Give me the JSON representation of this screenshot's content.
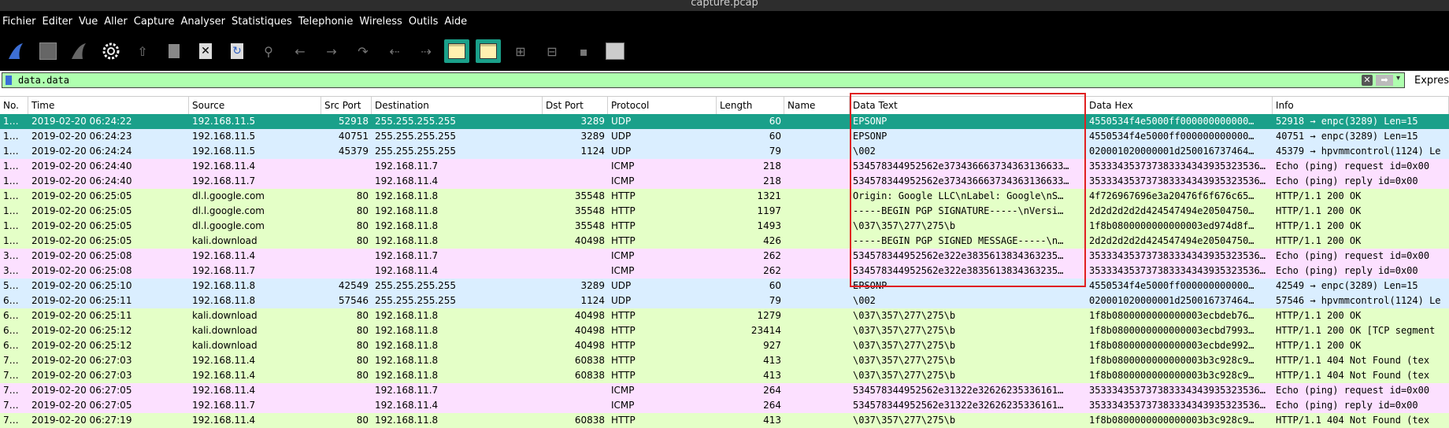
{
  "window": {
    "title": "capture.pcap"
  },
  "menu": [
    "Fichier",
    "Editer",
    "Vue",
    "Aller",
    "Capture",
    "Analyser",
    "Statistiques",
    "Telephonie",
    "Wireless",
    "Outils",
    "Aide"
  ],
  "toolbar": {
    "icons": [
      "shark-fin-icon",
      "stop-icon",
      "restart-icon",
      "options-gear-icon",
      "open-file-icon",
      "save-file-icon",
      "close-file-icon",
      "reload-icon",
      "find-icon",
      "back-icon",
      "forward-icon",
      "goto-icon",
      "first-icon",
      "last-icon",
      "autoscroll-icon",
      "colorize-icon",
      "zoom-in-icon",
      "zoom-out-icon",
      "normal-size-icon",
      "resize-columns-icon"
    ]
  },
  "filter": {
    "value": "data.data",
    "expression_label": "Express"
  },
  "columns": [
    "No.",
    "Time",
    "Source",
    "Src Port",
    "Destination",
    "Dst Port",
    "Protocol",
    "Length",
    "Name",
    "Data Text",
    "Data Hex",
    "Info"
  ],
  "packets": [
    {
      "no": "1…",
      "time": "2019-02-20 06:24:22",
      "src": "192.168.11.5",
      "sport": "52918",
      "dst": "255.255.255.255",
      "dport": "3289",
      "proto": "UDP",
      "len": "60",
      "name": "",
      "text": "EPSONP",
      "hex": "4550534f4e5000ff000000000000…",
      "info": "52918 → enpc(3289) Len=15",
      "cls": "sel"
    },
    {
      "no": "1…",
      "time": "2019-02-20 06:24:23",
      "src": "192.168.11.5",
      "sport": "40751",
      "dst": "255.255.255.255",
      "dport": "3289",
      "proto": "UDP",
      "len": "60",
      "name": "",
      "text": "EPSONP",
      "hex": "4550534f4e5000ff000000000000…",
      "info": "40751 → enpc(3289) Len=15",
      "cls": "udp"
    },
    {
      "no": "1…",
      "time": "2019-02-20 06:24:24",
      "src": "192.168.11.5",
      "sport": "45379",
      "dst": "255.255.255.255",
      "dport": "1124",
      "proto": "UDP",
      "len": "79",
      "name": "",
      "text": "\\002",
      "hex": "020001020000001d250016737464…",
      "info": "45379 → hpvmmcontrol(1124) Le",
      "cls": "udp"
    },
    {
      "no": "1…",
      "time": "2019-02-20 06:24:40",
      "src": "192.168.11.4",
      "sport": "",
      "dst": "192.168.11.7",
      "dport": "",
      "proto": "ICMP",
      "len": "218",
      "name": "",
      "text": "534578344952562e373436663734363136633…",
      "hex": "353334353737383334343935323536…",
      "info": "Echo (ping) request  id=0x00",
      "cls": "icmp"
    },
    {
      "no": "1…",
      "time": "2019-02-20 06:24:40",
      "src": "192.168.11.7",
      "sport": "",
      "dst": "192.168.11.4",
      "dport": "",
      "proto": "ICMP",
      "len": "218",
      "name": "",
      "text": "534578344952562e373436663734363136633…",
      "hex": "353334353737383334343935323536…",
      "info": "Echo (ping) reply    id=0x00",
      "cls": "icmp"
    },
    {
      "no": "1…",
      "time": "2019-02-20 06:25:05",
      "src": "dl.l.google.com",
      "sport": "80",
      "dst": "192.168.11.8",
      "dport": "35548",
      "proto": "HTTP",
      "len": "1321",
      "name": "",
      "text": "Origin: Google LLC\\nLabel: Google\\nS…",
      "hex": "4f726967696e3a20476f6f676c65…",
      "info": "HTTP/1.1 200 OK",
      "cls": "http"
    },
    {
      "no": "1…",
      "time": "2019-02-20 06:25:05",
      "src": "dl.l.google.com",
      "sport": "80",
      "dst": "192.168.11.8",
      "dport": "35548",
      "proto": "HTTP",
      "len": "1197",
      "name": "",
      "text": "-----BEGIN PGP SIGNATURE-----\\nVersi…",
      "hex": "2d2d2d2d2d424547494e20504750…",
      "info": "HTTP/1.1 200 OK",
      "cls": "http"
    },
    {
      "no": "1…",
      "time": "2019-02-20 06:25:05",
      "src": "dl.l.google.com",
      "sport": "80",
      "dst": "192.168.11.8",
      "dport": "35548",
      "proto": "HTTP",
      "len": "1493",
      "name": "",
      "text": "\\037\\357\\277\\275\\b",
      "hex": "1f8b0800000000000003ed974d8f…",
      "info": "HTTP/1.1 200 OK",
      "cls": "http"
    },
    {
      "no": "1…",
      "time": "2019-02-20 06:25:05",
      "src": "kali.download",
      "sport": "80",
      "dst": "192.168.11.8",
      "dport": "40498",
      "proto": "HTTP",
      "len": "426",
      "name": "",
      "text": "-----BEGIN PGP SIGNED MESSAGE-----\\n…",
      "hex": "2d2d2d2d2d424547494e20504750…",
      "info": "HTTP/1.1 200 OK",
      "cls": "http"
    },
    {
      "no": "3…",
      "time": "2019-02-20 06:25:08",
      "src": "192.168.11.4",
      "sport": "",
      "dst": "192.168.11.7",
      "dport": "",
      "proto": "ICMP",
      "len": "262",
      "name": "",
      "text": "534578344952562e322e3835613834363235…",
      "hex": "353334353737383334343935323536…",
      "info": "Echo (ping) request  id=0x00",
      "cls": "icmp"
    },
    {
      "no": "3…",
      "time": "2019-02-20 06:25:08",
      "src": "192.168.11.7",
      "sport": "",
      "dst": "192.168.11.4",
      "dport": "",
      "proto": "ICMP",
      "len": "262",
      "name": "",
      "text": "534578344952562e322e3835613834363235…",
      "hex": "353334353737383334343935323536…",
      "info": "Echo (ping) reply    id=0x00",
      "cls": "icmp"
    },
    {
      "no": "5…",
      "time": "2019-02-20 06:25:10",
      "src": "192.168.11.8",
      "sport": "42549",
      "dst": "255.255.255.255",
      "dport": "3289",
      "proto": "UDP",
      "len": "60",
      "name": "",
      "text": "EPSONP",
      "hex": "4550534f4e5000ff000000000000…",
      "info": "42549 → enpc(3289) Len=15",
      "cls": "udp"
    },
    {
      "no": "6…",
      "time": "2019-02-20 06:25:11",
      "src": "192.168.11.8",
      "sport": "57546",
      "dst": "255.255.255.255",
      "dport": "1124",
      "proto": "UDP",
      "len": "79",
      "name": "",
      "text": "\\002",
      "hex": "020001020000001d250016737464…",
      "info": "57546 → hpvmmcontrol(1124) Le",
      "cls": "udp"
    },
    {
      "no": "6…",
      "time": "2019-02-20 06:25:11",
      "src": "kali.download",
      "sport": "80",
      "dst": "192.168.11.8",
      "dport": "40498",
      "proto": "HTTP",
      "len": "1279",
      "name": "",
      "text": "\\037\\357\\277\\275\\b",
      "hex": "1f8b0800000000000003ecbdeb76…",
      "info": "HTTP/1.1 200 OK",
      "cls": "http"
    },
    {
      "no": "6…",
      "time": "2019-02-20 06:25:12",
      "src": "kali.download",
      "sport": "80",
      "dst": "192.168.11.8",
      "dport": "40498",
      "proto": "HTTP",
      "len": "23414",
      "name": "",
      "text": "\\037\\357\\277\\275\\b",
      "hex": "1f8b0800000000000003ecbd7993…",
      "info": "HTTP/1.1 200 OK  [TCP segment",
      "cls": "http"
    },
    {
      "no": "6…",
      "time": "2019-02-20 06:25:12",
      "src": "kali.download",
      "sport": "80",
      "dst": "192.168.11.8",
      "dport": "40498",
      "proto": "HTTP",
      "len": "927",
      "name": "",
      "text": "\\037\\357\\277\\275\\b",
      "hex": "1f8b0800000000000003ecbde992…",
      "info": "HTTP/1.1 200 OK",
      "cls": "http"
    },
    {
      "no": "7…",
      "time": "2019-02-20 06:27:03",
      "src": "192.168.11.4",
      "sport": "80",
      "dst": "192.168.11.8",
      "dport": "60838",
      "proto": "HTTP",
      "len": "413",
      "name": "",
      "text": "\\037\\357\\277\\275\\b",
      "hex": "1f8b0800000000000003b3c928c9…",
      "info": "HTTP/1.1 404 Not Found  (tex",
      "cls": "http"
    },
    {
      "no": "7…",
      "time": "2019-02-20 06:27:03",
      "src": "192.168.11.4",
      "sport": "80",
      "dst": "192.168.11.8",
      "dport": "60838",
      "proto": "HTTP",
      "len": "413",
      "name": "",
      "text": "\\037\\357\\277\\275\\b",
      "hex": "1f8b0800000000000003b3c928c9…",
      "info": "HTTP/1.1 404 Not Found  (tex",
      "cls": "http"
    },
    {
      "no": "7…",
      "time": "2019-02-20 06:27:05",
      "src": "192.168.11.4",
      "sport": "",
      "dst": "192.168.11.7",
      "dport": "",
      "proto": "ICMP",
      "len": "264",
      "name": "",
      "text": "534578344952562e31322e32626235336161…",
      "hex": "353334353737383334343935323536…",
      "info": "Echo (ping) request  id=0x00",
      "cls": "icmp"
    },
    {
      "no": "7…",
      "time": "2019-02-20 06:27:05",
      "src": "192.168.11.7",
      "sport": "",
      "dst": "192.168.11.4",
      "dport": "",
      "proto": "ICMP",
      "len": "264",
      "name": "",
      "text": "534578344952562e31322e32626235336161…",
      "hex": "353334353737383334343935323536…",
      "info": "Echo (ping) reply    id=0x00",
      "cls": "icmp"
    },
    {
      "no": "7…",
      "time": "2019-02-20 06:27:19",
      "src": "192.168.11.4",
      "sport": "80",
      "dst": "192.168.11.8",
      "dport": "60838",
      "proto": "HTTP",
      "len": "413",
      "name": "",
      "text": "\\037\\357\\277\\275\\b",
      "hex": "1f8b0800000000000003b3c928c9…",
      "info": "HTTP/1.1 404 Not Found  (tex",
      "cls": "http"
    }
  ]
}
